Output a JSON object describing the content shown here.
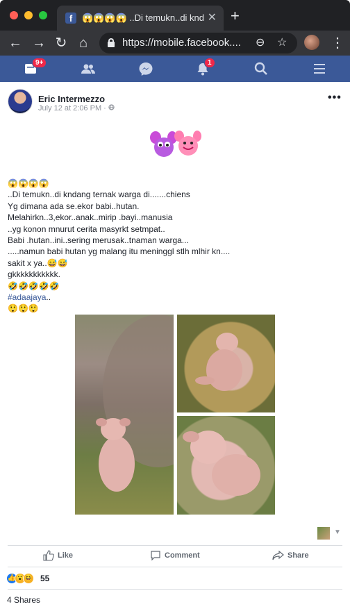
{
  "browser": {
    "tab_title": "😱😱😱😱 ..Di temukn..di kndang",
    "tab_favicon": "f",
    "url": "https://mobile.facebook....",
    "icons": [
      "back-icon",
      "forward-icon",
      "reload-icon",
      "home-icon",
      "lock-icon",
      "zoom-icon",
      "star-icon",
      "profile-avatar",
      "menu-icon",
      "close-icon",
      "new-tab-icon"
    ]
  },
  "fb_nav": {
    "feed_badge": "9+",
    "notifications_badge": "1",
    "icons": [
      "news-feed-icon",
      "friends-icon",
      "messenger-icon",
      "bell-icon",
      "search-icon",
      "hamburger-menu-icon"
    ],
    "colors": {
      "bar": "#3b5998",
      "badge": "#f02849"
    }
  },
  "post": {
    "author": "Eric Intermezzo",
    "timestamp": "July 12 at 2:06 PM · ",
    "lines": [
      "😱😱😱😱",
      "..Di temukn..di kndang ternak warga di.......chiens",
      "Yg dimana ada se.ekor babi..hutan.",
      "Melahirkn..3,ekor..anak..mirip .bayi..manusia",
      "..yg konon mnurut cerita masyrkt setmpat..",
      "Babi .hutan..ini..sering merusak..tnaman warga...",
      ".....namun babi hutan yg malang itu meninggl stlh mlhir kn....",
      "sakit x ya..😅😅",
      "gkkkkkkkkkkk.",
      "🤣🤣🤣🤣🤣"
    ],
    "hashtag": "#adaajaya",
    "hashtag_suffix": "..",
    "last_line": "😲😲😲",
    "actions": {
      "like": "Like",
      "comment": "Comment",
      "share": "Share"
    },
    "reaction_count": "55",
    "shares": "4 Shares",
    "colors": {
      "link": "#385898",
      "text": "#1d2129",
      "muted": "#90949c"
    }
  }
}
